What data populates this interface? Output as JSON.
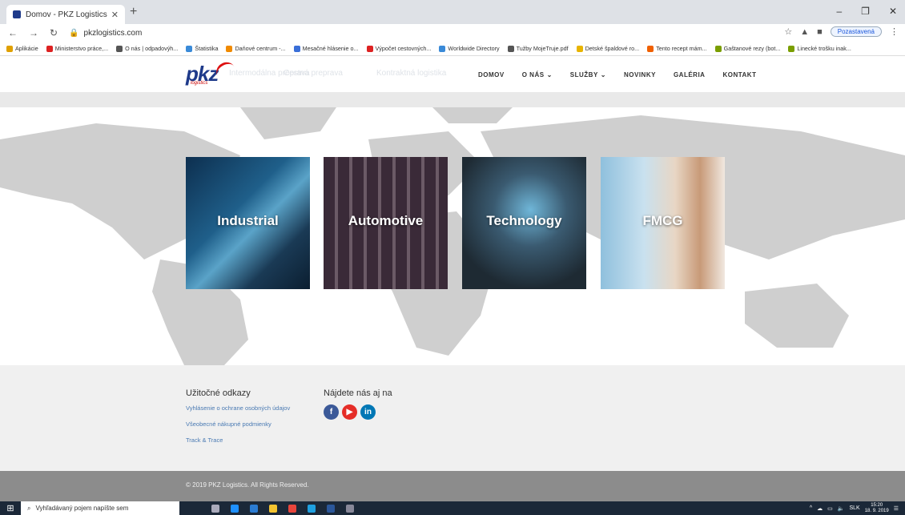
{
  "browser": {
    "tab_title": "Domov - PKZ Logistics",
    "new_tab": "+",
    "url": "pkzlogistics.com",
    "profile_status": "Pozastavená",
    "window_controls": [
      "–",
      "❐",
      "✕"
    ]
  },
  "bookmarks": [
    {
      "label": "Aplikácie",
      "color": "#e0a000"
    },
    {
      "label": "Ministerstvo práce,...",
      "color": "#d22"
    },
    {
      "label": "O nás | odpadovýh...",
      "color": "#555"
    },
    {
      "label": "Štatistika",
      "color": "#3a8ad8"
    },
    {
      "label": "Daňové centrum -...",
      "color": "#f08a00"
    },
    {
      "label": "Mesačné hlásenie o...",
      "color": "#3a6fd8"
    },
    {
      "label": "Výpočet cestovných...",
      "color": "#d22"
    },
    {
      "label": "Worldwide Directory",
      "color": "#3a8ad8"
    },
    {
      "label": "Tužby MojeTruje.pdf",
      "color": "#555"
    },
    {
      "label": "Detské špaldové ro...",
      "color": "#e8b400"
    },
    {
      "label": "Tento recept mám...",
      "color": "#f06000"
    },
    {
      "label": "Gaštanové rezy (bot...",
      "color": "#7a9e00"
    },
    {
      "label": "Linecké trošku inak...",
      "color": "#7a9e00"
    }
  ],
  "site": {
    "logo_text": "pkz",
    "logo_sub": "logistics",
    "ghost_links": [
      "Intermodálna preprava",
      "Cestná preprava",
      "Kontraktná logistika"
    ],
    "nav": [
      {
        "label": "DOMOV",
        "caret": ""
      },
      {
        "label": "O NÁS",
        "caret": "⌄"
      },
      {
        "label": "SLUŽBY",
        "caret": "⌄"
      },
      {
        "label": "NOVINKY",
        "caret": ""
      },
      {
        "label": "GALÉRIA",
        "caret": ""
      },
      {
        "label": "KONTAKT",
        "caret": ""
      }
    ]
  },
  "tiles": [
    {
      "label": "Industrial"
    },
    {
      "label": "Automotive"
    },
    {
      "label": "Technology"
    },
    {
      "label": "FMCG"
    }
  ],
  "footer": {
    "links_heading": "Užitočné odkazy",
    "links": [
      "Vyhlásenie o ochrane osobných údajov",
      "Všeobecné nákupné podmienky",
      "Track & Trace"
    ],
    "social_heading": "Nájdete nás aj na",
    "social": [
      {
        "icon": "facebook-icon",
        "glyph": "f",
        "color": "#3b5998"
      },
      {
        "icon": "youtube-icon",
        "glyph": "▶",
        "color": "#e52d27"
      },
      {
        "icon": "linkedin-icon",
        "glyph": "in",
        "color": "#0077b5"
      }
    ],
    "copyright": "© 2019 PKZ Logistics. All Rights Reserved."
  },
  "taskbar": {
    "search_placeholder": "Vyhľadávaný pojem napíšte sem",
    "language": "SLK",
    "time": "15:20",
    "date": "18. 9. 2019"
  }
}
